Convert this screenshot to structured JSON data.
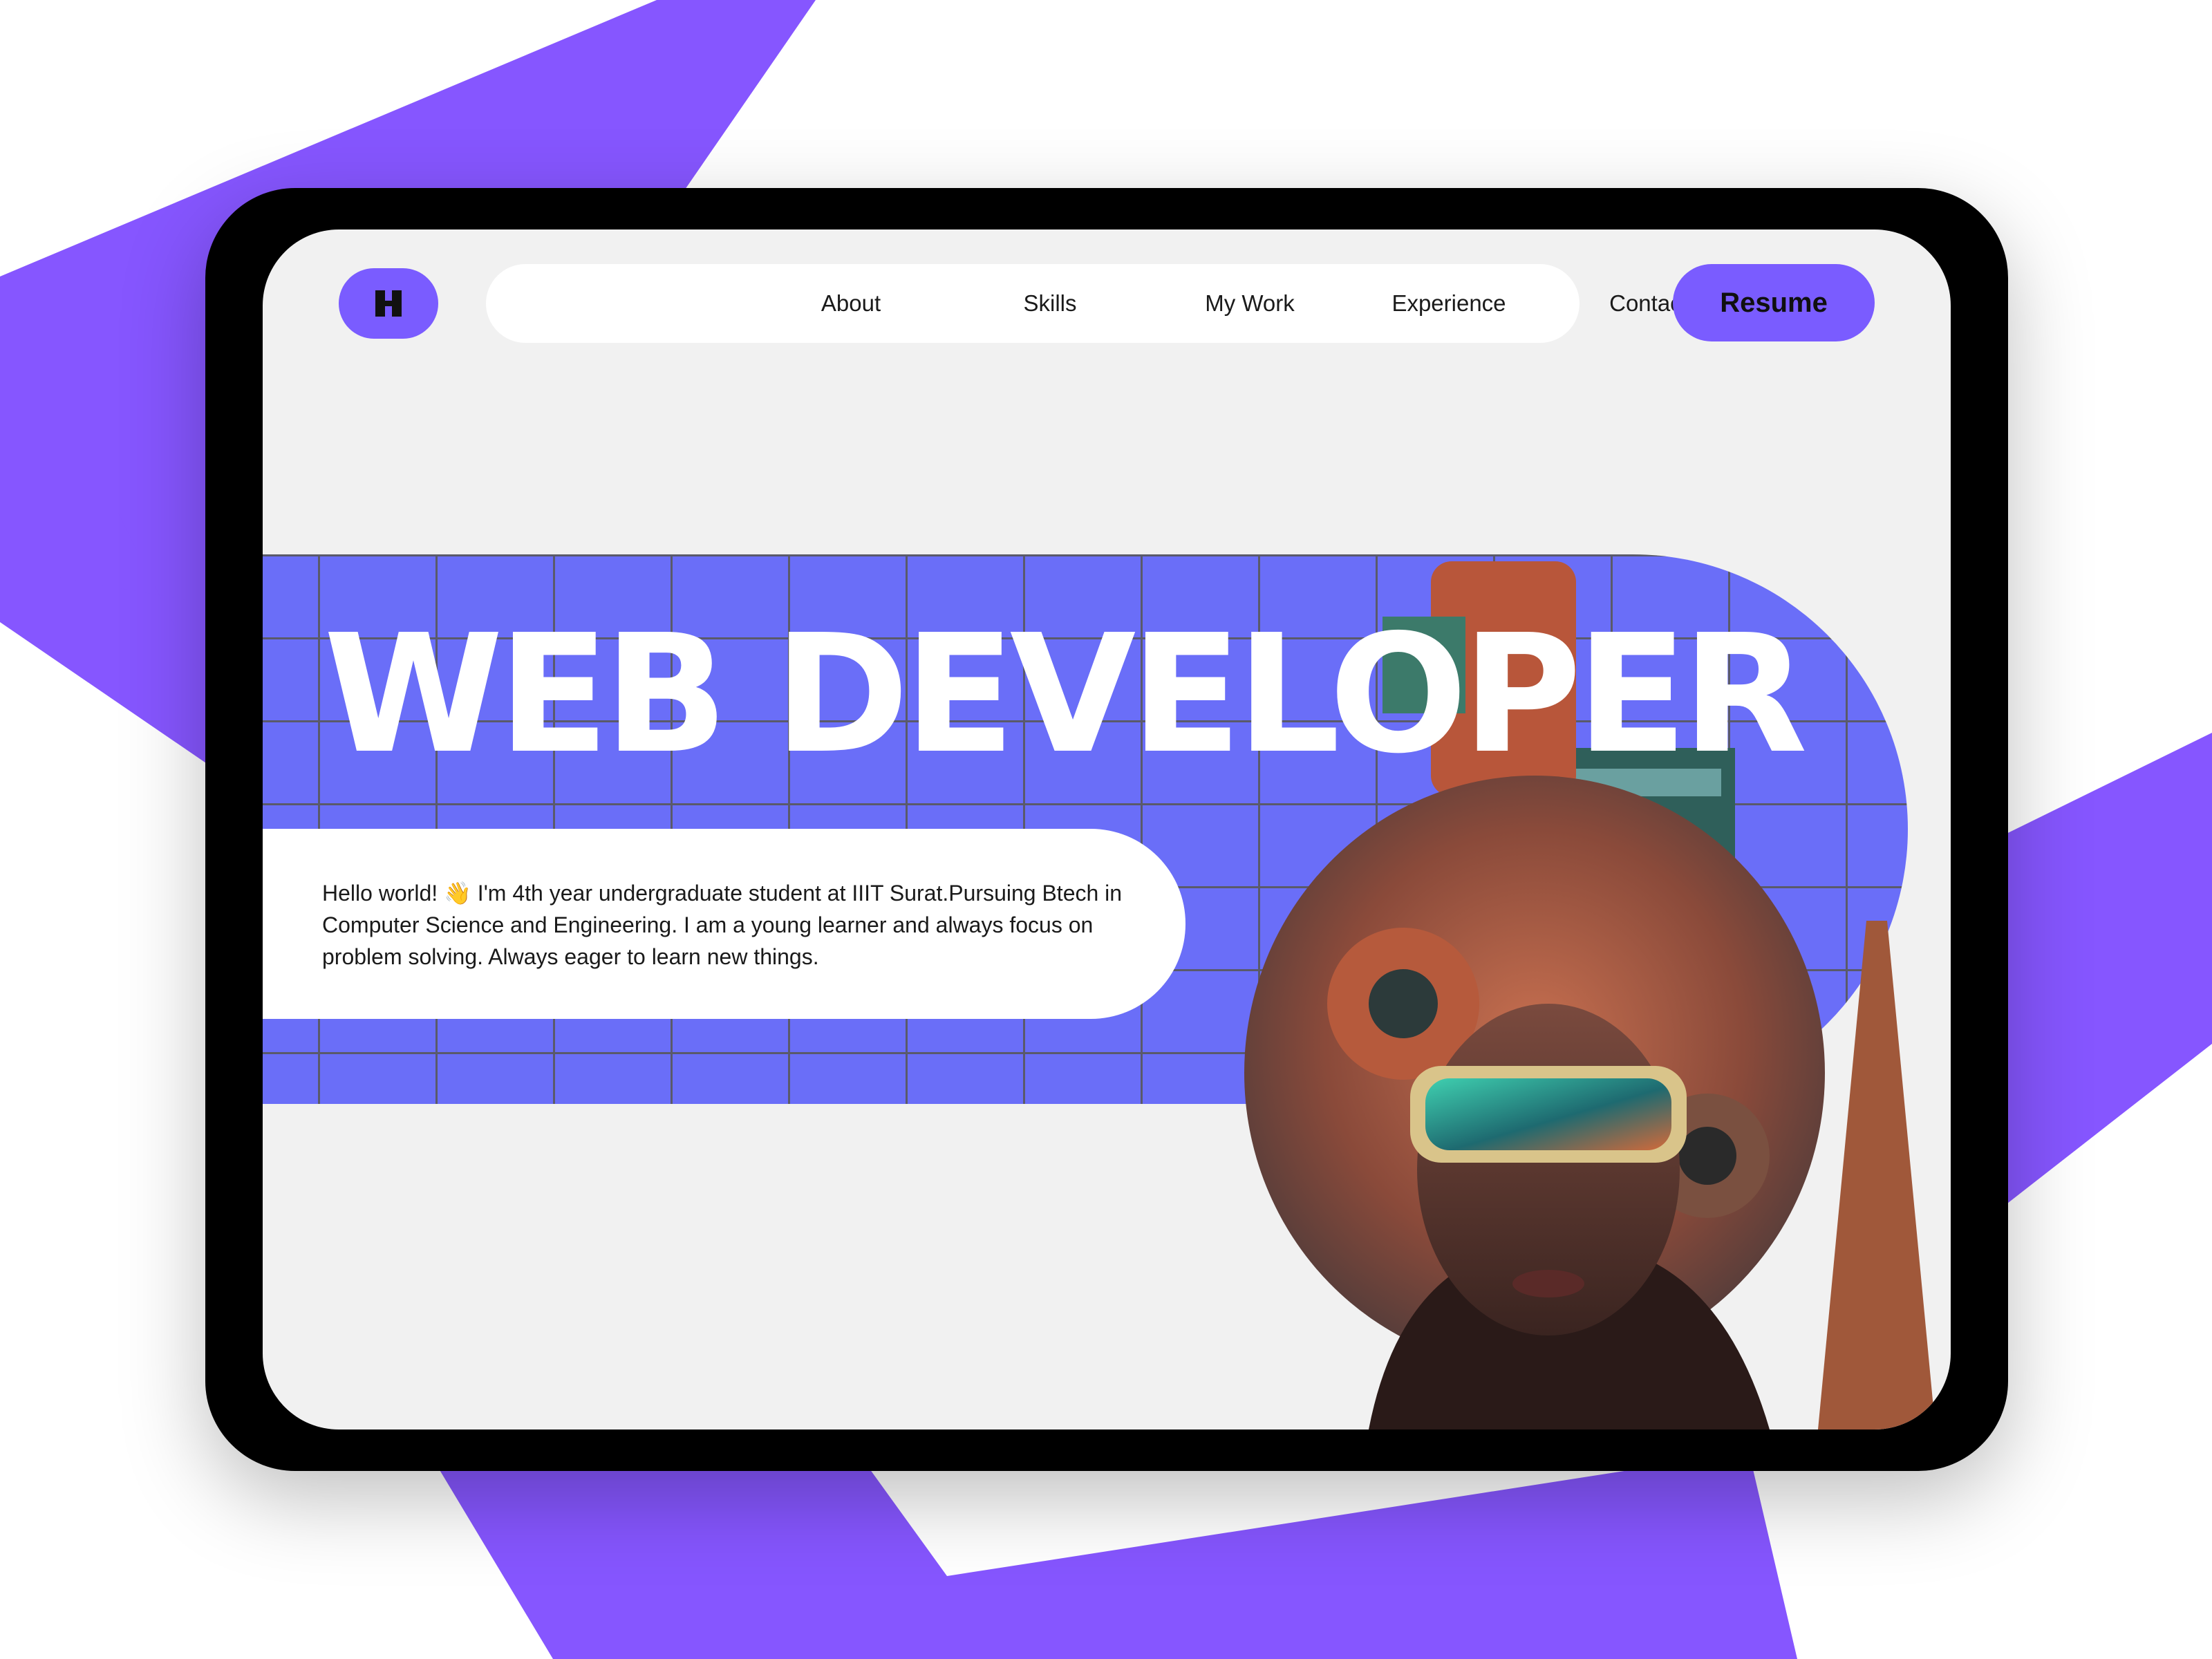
{
  "colors": {
    "accent_purple": "#8656ff",
    "band_blue": "#6a6ef8",
    "device_frame": "#000000",
    "screen_bg": "#f1f1f1"
  },
  "logo": {
    "icon": "h-logo-icon"
  },
  "nav": {
    "items": [
      {
        "label": "About"
      },
      {
        "label": "Skills"
      },
      {
        "label": "My Work"
      },
      {
        "label": "Experience"
      },
      {
        "label": "Contact"
      }
    ]
  },
  "resume": {
    "label": "Resume"
  },
  "hero": {
    "headline": "WEB DEVELOPER",
    "intro": "Hello world! 👋 I'm 4th year undergraduate student at IIIT Surat.Pursuing Btech in Computer Science and Engineering. I am a young learner and always focus on problem solving. Always eager to learn new things.",
    "image": "vr-headset-portrait-collage"
  }
}
